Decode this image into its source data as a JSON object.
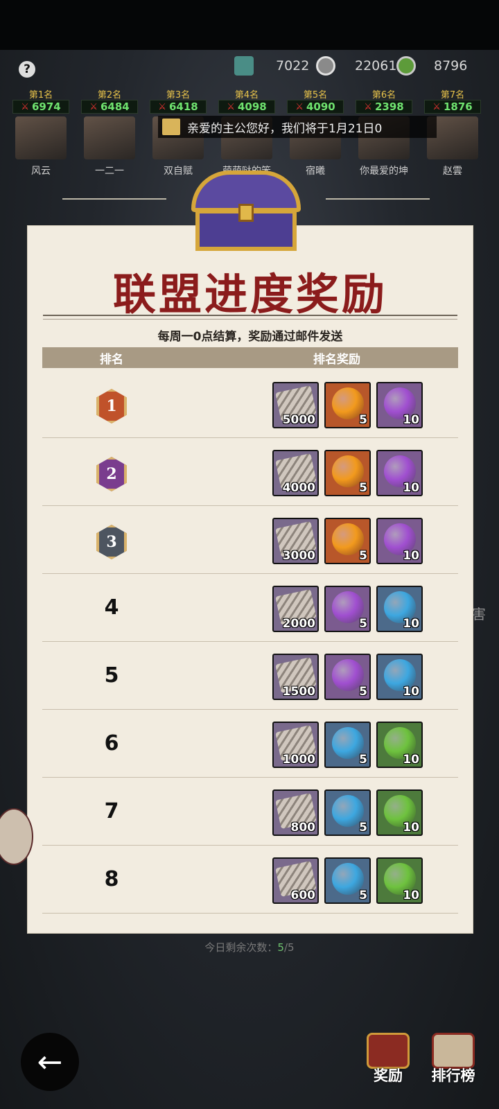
{
  "header": {
    "help_glyph": "?",
    "resources": [
      {
        "icon": "tower-icon",
        "value": "7022"
      },
      {
        "icon": "coin-icon",
        "value": "22061"
      },
      {
        "icon": "jade-icon",
        "value": "8796"
      }
    ]
  },
  "leaderboard": [
    {
      "place": "第1名",
      "score": "6974",
      "name": "风云"
    },
    {
      "place": "第2名",
      "score": "6484",
      "name": "一二一"
    },
    {
      "place": "第3名",
      "score": "6418",
      "name": "双自赋"
    },
    {
      "place": "第4名",
      "score": "4098",
      "name": "萌萌哒的笨"
    },
    {
      "place": "第5名",
      "score": "4090",
      "name": "宿曦"
    },
    {
      "place": "第6名",
      "score": "2398",
      "name": "你最爱的坤"
    },
    {
      "place": "第7名",
      "score": "1876",
      "name": "赵雲"
    }
  ],
  "notice": {
    "text": "亲爱的主公您好，我们将于1月21日0"
  },
  "panel": {
    "title": "联盟进度奖励",
    "subtitle": "每周一0点结算，奖励通过邮件发送",
    "col_rank": "排名",
    "col_reward": "排名奖励",
    "rows": [
      {
        "rank": "1",
        "badge": "gold",
        "items": [
          {
            "type": "scroll",
            "qty": "5000"
          },
          {
            "type": "orb-orange",
            "qty": "5"
          },
          {
            "type": "orb-purple",
            "qty": "10"
          }
        ]
      },
      {
        "rank": "2",
        "badge": "purple",
        "items": [
          {
            "type": "scroll",
            "qty": "4000"
          },
          {
            "type": "orb-orange",
            "qty": "5"
          },
          {
            "type": "orb-purple",
            "qty": "10"
          }
        ]
      },
      {
        "rank": "3",
        "badge": "slate",
        "items": [
          {
            "type": "scroll",
            "qty": "3000"
          },
          {
            "type": "orb-orange",
            "qty": "5"
          },
          {
            "type": "orb-purple",
            "qty": "10"
          }
        ]
      },
      {
        "rank": "4",
        "badge": "",
        "items": [
          {
            "type": "scroll",
            "qty": "2000"
          },
          {
            "type": "orb-purple",
            "qty": "5"
          },
          {
            "type": "orb-blue",
            "qty": "10"
          }
        ]
      },
      {
        "rank": "5",
        "badge": "",
        "items": [
          {
            "type": "scroll",
            "qty": "1500"
          },
          {
            "type": "orb-purple",
            "qty": "5"
          },
          {
            "type": "orb-blue",
            "qty": "10"
          }
        ]
      },
      {
        "rank": "6",
        "badge": "",
        "items": [
          {
            "type": "scroll",
            "qty": "1000"
          },
          {
            "type": "orb-blue",
            "qty": "5"
          },
          {
            "type": "orb-green",
            "qty": "10"
          }
        ]
      },
      {
        "rank": "7",
        "badge": "",
        "items": [
          {
            "type": "scroll",
            "qty": "800"
          },
          {
            "type": "orb-blue",
            "qty": "5"
          },
          {
            "type": "orb-green",
            "qty": "10"
          }
        ]
      },
      {
        "rank": "8",
        "badge": "",
        "items": [
          {
            "type": "scroll",
            "qty": "600"
          },
          {
            "type": "orb-blue",
            "qty": "5"
          },
          {
            "type": "orb-green",
            "qty": "10"
          }
        ]
      }
    ]
  },
  "remaining": {
    "label": "今日剩余次数：",
    "current": "5",
    "total": "/5"
  },
  "side_char": "害",
  "bottom_nav": {
    "reward_label": "奖励",
    "ranking_label": "排行榜",
    "back_glyph": "←"
  },
  "colors": {
    "title_red": "#8b1c1c",
    "badge_gold": "#c0522a",
    "badge_purple": "#7a3d8e",
    "badge_slate": "#4d5560",
    "orb_orange": "#f29a1d",
    "orb_purple": "#a04fd0",
    "orb_blue": "#3da7e0",
    "orb_green": "#6ec23e"
  }
}
